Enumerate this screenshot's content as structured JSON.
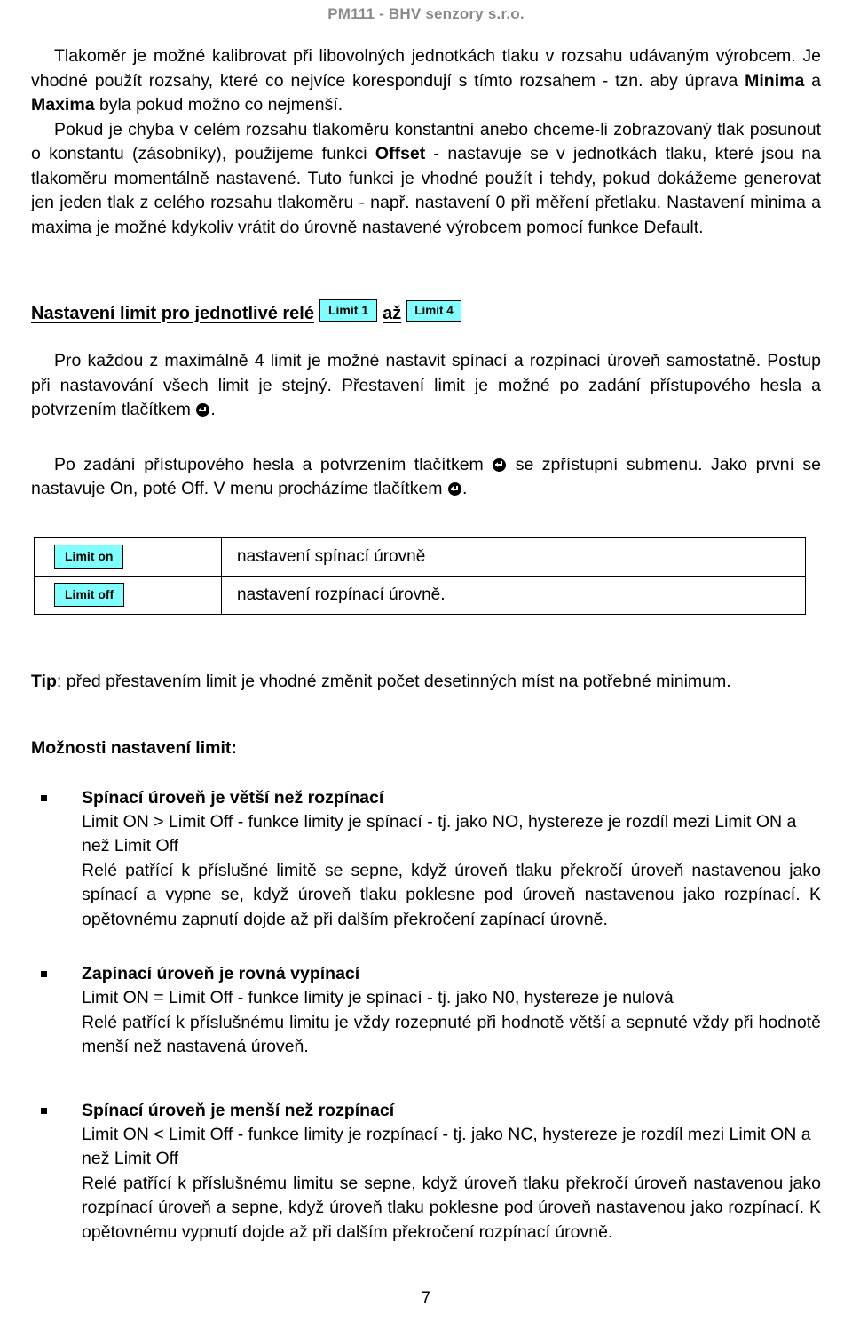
{
  "header": {
    "running_title": "PM111 - BHV senzory s.r.o."
  },
  "intro": {
    "p1_part1": "Tlakoměr je možné kalibrovat při libovolných jednotkách tlaku v rozsahu udávaným výrobcem. Je vhodné použít rozsahy, které co nejvíce korespondují s tímto rozsahem - tzn. aby úprava ",
    "p1_bold1": "Minima",
    "p1_part2": " a ",
    "p1_bold2": "Maxima",
    "p1_part3": " byla pokud možno co nejmenší.",
    "p2_part1": "Pokud je chyba v celém rozsahu tlakoměru konstantní anebo chceme-li zobrazovaný tlak posunout o konstantu (zásobníky), použijeme funkci ",
    "p2_bold1": "Offset",
    "p2_part2": " - nastavuje se v jednotkách tlaku, které jsou na tlakoměru momentálně nastavené. Tuto funkci je vhodné použít i tehdy, pokud dokážeme generovat jen jeden tlak z celého rozsahu tlakoměru - např. nastavení 0 při měření přetlaku. Nastavení minima a maxima je možné kdykoliv vrátit do úrovně nastavené výrobcem pomocí funkce Default."
  },
  "limit_section": {
    "heading_text": "Nastavení limit pro jednotlivé relé",
    "chip_first": "Limit 1",
    "heading_conjunction": "až",
    "chip_last": "Limit 4",
    "p1_part1": "Pro každou z maximálně 4 limit je možné nastavit spínací a rozpínací úroveň samostatně. Postup při nastavování všech limit je stejný. Přestavení limit je možné po zadání přístupového hesla a potvrzením tlačítkem ",
    "p1_part2": ".",
    "p2_part1": "Po zadání přístupového hesla a potvrzením tlačítkem ",
    "p2_part2": " se zpřístupní submenu. Jako první se nastavuje On, poté Off. V menu procházíme tlačítkem ",
    "p2_part3": "."
  },
  "limit_table": {
    "rows": [
      {
        "badge": "Limit on",
        "description": "nastavení spínací úrovně"
      },
      {
        "badge": "Limit off",
        "description": "nastavení rozpínací úrovně."
      }
    ]
  },
  "tip": {
    "label": "Tip",
    "text": ": před přestavením limit je vhodné změnit počet desetinných míst na potřebné minimum."
  },
  "options": {
    "heading": "Možnosti nastavení limit:",
    "items": [
      {
        "title": "Spínací úroveň je větší než rozpínací",
        "line1": "Limit ON > Limit Off - funkce limity je spínací - tj. jako NO, hystereze je rozdíl mezi Limit ON a než Limit Off",
        "line2": "Relé patřící k příslušné limitě se sepne, když úroveň tlaku překročí úroveň nastavenou jako spínací a vypne se, když úroveň tlaku poklesne pod úroveň nastavenou jako rozpínací. K opětovnému zapnutí dojde až při dalším překročení zapínací úrovně."
      },
      {
        "title": "Zapínací úroveň je rovná vypínací",
        "line1": "Limit ON = Limit Off - funkce limity je spínací - tj. jako N0, hystereze je nulová",
        "line2": "Relé patřící k příslušnému limitu je vždy rozepnuté při hodnotě větší a sepnuté vždy při hodnotě menší než nastavená úroveň."
      },
      {
        "title": "Spínací úroveň je menší než rozpínací",
        "line1": "Limit ON < Limit Off - funkce limity je rozpínací - tj. jako NC, hystereze je rozdíl mezi Limit ON a než Limit Off",
        "line2": "Relé patřící k příslušnému limitu se sepne, když úroveň tlaku překročí úroveň nastavenou jako rozpínací úroveň a sepne, když úroveň tlaku poklesne pod úroveň nastavenou jako rozpínací. K opětovnému vypnutí dojde až při dalším překročení rozpínací úrovně."
      }
    ]
  },
  "footer": {
    "page_number": "7"
  },
  "colors": {
    "chip_fill": "#80ffff",
    "header_gray": "#8a8a8a",
    "text": "#000000"
  }
}
